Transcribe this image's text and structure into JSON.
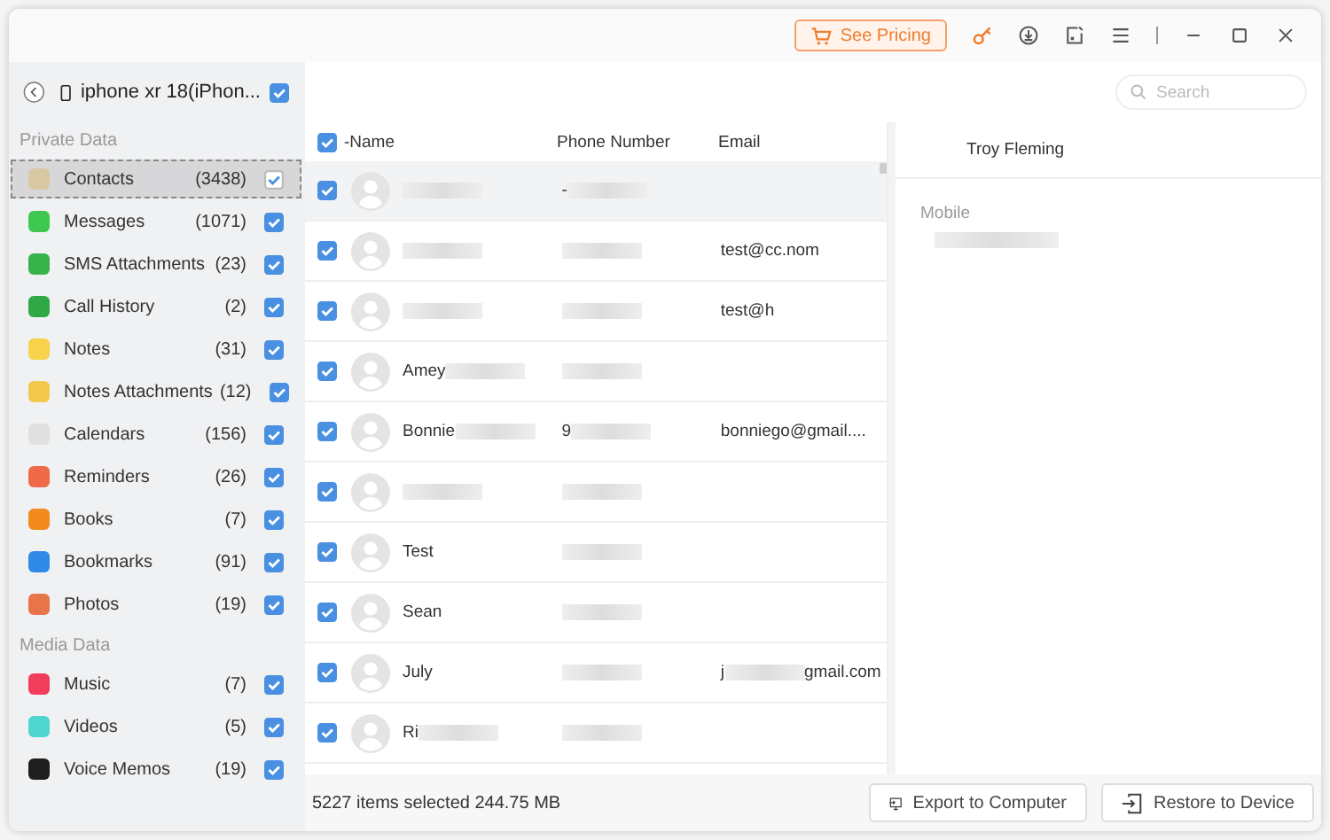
{
  "title_bar": {
    "pricing_button": "See Pricing"
  },
  "device": {
    "name": "iphone xr 18(iPhon...",
    "checked": true
  },
  "sidebar": {
    "sections": [
      {
        "title": "Private Data",
        "items": [
          {
            "label": "Contacts",
            "count": "(3438)",
            "checked": true,
            "selected": true,
            "color": "#d9c9a3"
          },
          {
            "label": "Messages",
            "count": "(1071)",
            "checked": true,
            "selected": false,
            "color": "#3fc84f"
          },
          {
            "label": "SMS Attachments",
            "count": "(23)",
            "checked": true,
            "selected": false,
            "color": "#36b34a"
          },
          {
            "label": "Call History",
            "count": "(2)",
            "checked": true,
            "selected": false,
            "color": "#2fa845"
          },
          {
            "label": "Notes",
            "count": "(31)",
            "checked": true,
            "selected": false,
            "color": "#f7d24a"
          },
          {
            "label": "Notes Attachments",
            "count": "(12)",
            "checked": true,
            "selected": false,
            "color": "#f2c94c"
          },
          {
            "label": "Calendars",
            "count": "(156)",
            "checked": true,
            "selected": false,
            "color": "#e0e0e0"
          },
          {
            "label": "Reminders",
            "count": "(26)",
            "checked": true,
            "selected": false,
            "color": "#f06a4a"
          },
          {
            "label": "Books",
            "count": "(7)",
            "checked": true,
            "selected": false,
            "color": "#f28a1e"
          },
          {
            "label": "Bookmarks",
            "count": "(91)",
            "checked": true,
            "selected": false,
            "color": "#2e8ae6"
          },
          {
            "label": "Photos",
            "count": "(19)",
            "checked": true,
            "selected": false,
            "color": "#e8744a"
          }
        ]
      },
      {
        "title": "Media Data",
        "items": [
          {
            "label": "Music",
            "count": "(7)",
            "checked": true,
            "selected": false,
            "color": "#f03d5a"
          },
          {
            "label": "Videos",
            "count": "(5)",
            "checked": true,
            "selected": false,
            "color": "#4fd6d0"
          },
          {
            "label": "Voice Memos",
            "count": "(19)",
            "checked": true,
            "selected": false,
            "color": "#1e1e1e"
          }
        ]
      }
    ]
  },
  "search": {
    "placeholder": "Search"
  },
  "table": {
    "all_checked": true,
    "columns": [
      "-Name",
      "Phone Number",
      "Email"
    ],
    "rows": [
      {
        "checked": true,
        "selected": true,
        "name": [
          {
            "kind": "redacted"
          }
        ],
        "phone": [
          {
            "kind": "text",
            "text": "-"
          },
          {
            "kind": "redacted"
          }
        ],
        "email": []
      },
      {
        "checked": true,
        "selected": false,
        "name": [
          {
            "kind": "redacted"
          }
        ],
        "phone": [
          {
            "kind": "redacted"
          }
        ],
        "email": [
          {
            "kind": "text",
            "text": "test@cc.nom"
          }
        ]
      },
      {
        "checked": true,
        "selected": false,
        "name": [
          {
            "kind": "redacted"
          }
        ],
        "phone": [
          {
            "kind": "redacted"
          }
        ],
        "email": [
          {
            "kind": "text",
            "text": "test@h"
          }
        ]
      },
      {
        "checked": true,
        "selected": false,
        "name": [
          {
            "kind": "text",
            "text": "Amey"
          },
          {
            "kind": "redacted"
          }
        ],
        "phone": [
          {
            "kind": "redacted"
          }
        ],
        "email": []
      },
      {
        "checked": true,
        "selected": false,
        "name": [
          {
            "kind": "text",
            "text": "Bonnie"
          },
          {
            "kind": "redacted"
          }
        ],
        "phone": [
          {
            "kind": "text",
            "text": "9"
          },
          {
            "kind": "redacted"
          }
        ],
        "email": [
          {
            "kind": "text",
            "text": "bonniego@gmail...."
          }
        ]
      },
      {
        "checked": true,
        "selected": false,
        "name": [
          {
            "kind": "redacted"
          }
        ],
        "phone": [
          {
            "kind": "redacted"
          }
        ],
        "email": []
      },
      {
        "checked": true,
        "selected": false,
        "name": [
          {
            "kind": "text",
            "text": "Test"
          }
        ],
        "phone": [
          {
            "kind": "redacted"
          }
        ],
        "email": []
      },
      {
        "checked": true,
        "selected": false,
        "name": [
          {
            "kind": "text",
            "text": "Sean"
          }
        ],
        "phone": [
          {
            "kind": "redacted"
          }
        ],
        "email": []
      },
      {
        "checked": true,
        "selected": false,
        "name": [
          {
            "kind": "text",
            "text": "July"
          }
        ],
        "phone": [
          {
            "kind": "redacted"
          }
        ],
        "email": [
          {
            "kind": "text",
            "text": "j"
          },
          {
            "kind": "redacted"
          },
          {
            "kind": "text",
            "text": "gmail.com"
          }
        ]
      },
      {
        "checked": true,
        "selected": false,
        "name": [
          {
            "kind": "text",
            "text": "Ri"
          },
          {
            "kind": "redacted"
          }
        ],
        "phone": [
          {
            "kind": "redacted"
          }
        ],
        "email": []
      }
    ]
  },
  "detail": {
    "name": "Troy Fleming",
    "fields": [
      {
        "label": "Mobile",
        "value": [
          {
            "kind": "redacted"
          }
        ]
      }
    ]
  },
  "footer": {
    "summary": "5227 items selected 244.75 MB",
    "buttons": [
      {
        "kind": "export",
        "label": "Export to Computer"
      },
      {
        "kind": "restore",
        "label": "Restore to Device"
      }
    ]
  }
}
